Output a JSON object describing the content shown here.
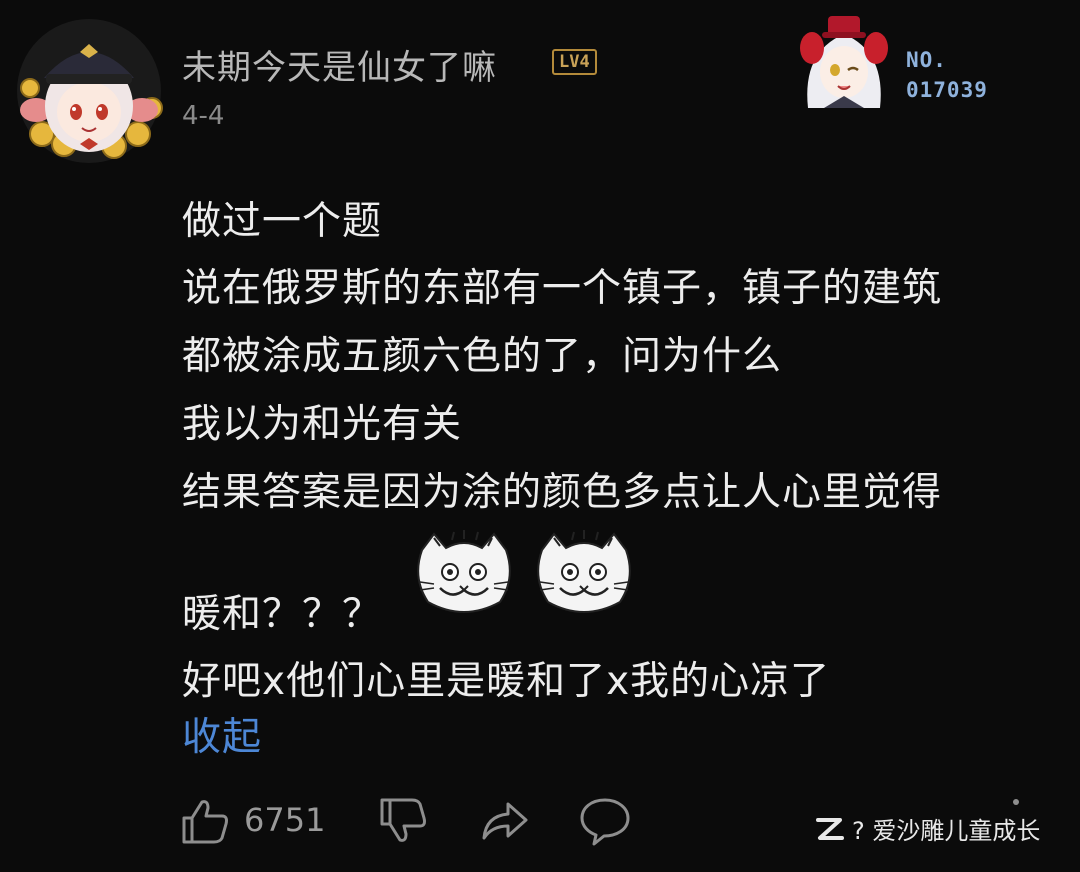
{
  "comment": {
    "author": {
      "name": "未期今天是仙女了嘛",
      "level": "LV4",
      "avatar_icon": "anime-girl-pilot-hat-avatar-with-gold-coins"
    },
    "date": "4-4",
    "fan_card": {
      "label": "NO.",
      "number": "017039",
      "image_icon": "white-haired-anime-girl-fan-badge"
    },
    "lines": [
      "做过一个题",
      "说在俄罗斯的东部有一个镇子，镇子的建筑",
      "都被涂成五颜六色的了，问为什么",
      "我以为和光有关",
      "结果答案是因为涂的颜色多点让人心里觉得",
      "暖和？？？",
      "好吧x他们心里是暖和了x我的心凉了"
    ],
    "stickers": [
      "laughing-cat-emoji",
      "laughing-cat-emoji"
    ],
    "collapse_label": "收起"
  },
  "actions": {
    "like_icon": "thumbs-up-icon",
    "like_count": "6751",
    "dislike_icon": "thumbs-down-icon",
    "share_icon": "share-arrow-icon",
    "reply_icon": "comment-bubble-icon"
  },
  "watermark": {
    "icon": "zhihu-logo-icon",
    "text": "? 爱沙雕儿童成长"
  },
  "colors": {
    "background": "#0b0b0b",
    "text": "#ededed",
    "username": "#b8b8b8",
    "link": "#4d87d6",
    "level_badge": "#c9a257",
    "fan_number": "#8fb2dc"
  }
}
